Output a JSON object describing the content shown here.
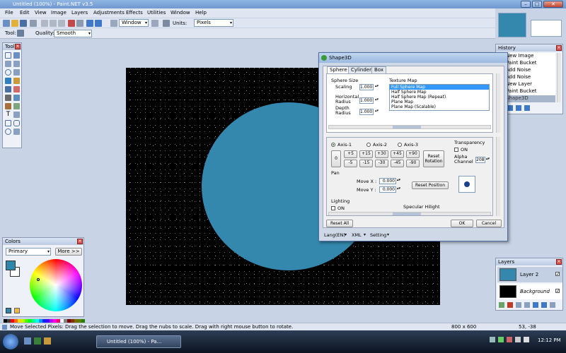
{
  "window": {
    "title": "Untitled (100%) - Paint.NET v3.5",
    "min": "–",
    "max": "□",
    "close": "✕"
  },
  "menu": [
    "File",
    "Edit",
    "View",
    "Image",
    "Layers",
    "Adjustments",
    "Effects",
    "Utilities",
    "Window",
    "Help"
  ],
  "toolbar": {
    "window_label": "Window",
    "units_label": "Units:",
    "units_value": "Pixels"
  },
  "toolbar2": {
    "tool_label": "Tool:",
    "quality_label": "Quality:",
    "quality_value": "Smooth"
  },
  "tools_panel": {
    "title": "Tools"
  },
  "history_panel": {
    "title": "History",
    "items": [
      "New Image",
      "Paint Bucket",
      "Add Noise",
      "Add Noise",
      "New Layer",
      "Paint Bucket",
      "Shape3D"
    ]
  },
  "colors_panel": {
    "title": "Colors",
    "mode": "Primary",
    "more_button": "More >>",
    "primary_color": "#2f86ab",
    "secondary_color": "#ffffff"
  },
  "layers_panel": {
    "title": "Layers",
    "layers": [
      {
        "name": "Layer 2",
        "swatch": "#3488ad",
        "checked": "✓"
      },
      {
        "name": "Background",
        "swatch": "#000000",
        "checked": "✓"
      }
    ]
  },
  "canvas": {
    "background": "#000000",
    "sphere_color": "#3488ad"
  },
  "dialog": {
    "title": "Shape3D",
    "tabs": [
      "Sphere",
      "Cylinder",
      "Box"
    ],
    "sphere_size": {
      "header": "Sphere Size",
      "scaling_label": "Scaling",
      "scaling_value": "1.000",
      "hradius_label": "Horizontal Radius",
      "hradius_value": "1.000",
      "depth_label": "Depth Radius",
      "depth_value": "1.000"
    },
    "texture_map": {
      "header": "Texture Map",
      "options": [
        "Full Sphere Map",
        "Half Sphere Map",
        "Half Sphere Map (Repeat)",
        "Plane Map",
        "Plane Map (Scalable)"
      ],
      "selected": "Full Sphere Map"
    },
    "rotation": {
      "axes": [
        "Axis-1",
        "Axis-2",
        "Axis-3"
      ],
      "zero": "0",
      "row1": [
        "+5",
        "+15",
        "+30",
        "+45",
        "+90"
      ],
      "row2": [
        "-5",
        "-15",
        "-30",
        "-45",
        "-90"
      ],
      "reset": "Reset Rotation"
    },
    "transparency": {
      "header": "Transparency",
      "on_label": "ON",
      "alpha_label": "Alpha Channel",
      "alpha_value": "208"
    },
    "pan": {
      "header": "Pan",
      "movex_label": "Move X :",
      "movex_value": "0.000",
      "movey_label": "Move Y :",
      "movey_value": "0.000",
      "reset": "Reset Position"
    },
    "lighting": {
      "header": "Lighting",
      "on_label": "ON",
      "specular_label": "Specular Hilight"
    },
    "reset_all": "Reset All",
    "ok": "OK",
    "cancel": "Cancel",
    "bottom_menu": [
      "Lang(EN)",
      "XML",
      "Setting"
    ]
  },
  "statusbar": {
    "message": "Move Selected Pixels: Drag the selection to move. Drag the nubs to scale. Drag with right mouse button to rotate.",
    "size": "800 x 600",
    "coords": "53, -38"
  },
  "taskbar": {
    "app": "Untitled (100%) - Pa...",
    "clock": "12:12 PM"
  }
}
